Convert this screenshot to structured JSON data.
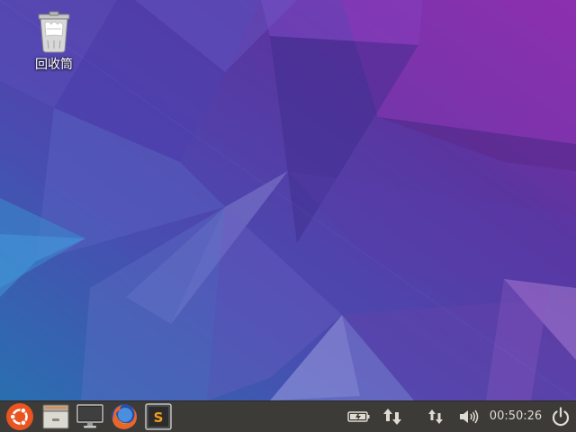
{
  "desktop": {
    "icons": [
      {
        "label": "回收筒",
        "icon": "trash-icon"
      }
    ]
  },
  "panel": {
    "launchers": [
      {
        "name": "ubuntu-logo",
        "icon": "ubuntu-logo-icon"
      },
      {
        "name": "file-manager",
        "icon": "file-manager-icon"
      },
      {
        "name": "display",
        "icon": "monitor-icon"
      },
      {
        "name": "firefox",
        "icon": "firefox-icon"
      },
      {
        "name": "sublime-text",
        "icon": "sublime-text-icon"
      }
    ],
    "tray": {
      "battery": "battery-charging-icon",
      "network": "network-transfer-icon",
      "network_small": "network-arrows-icon",
      "volume": "volume-icon",
      "power": "power-icon"
    },
    "clock": "00:50:26"
  },
  "colors": {
    "panel_bg": "#3c3b37",
    "panel_text": "#dfdbd2",
    "ubuntu_orange": "#e95420"
  }
}
